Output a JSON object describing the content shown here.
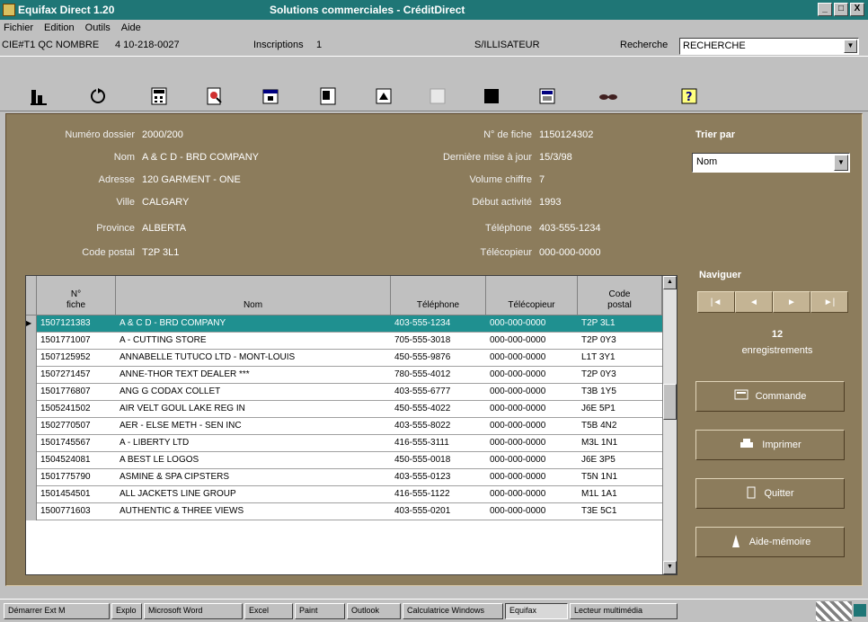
{
  "window": {
    "title_left": "Equifax Direct 1.20",
    "title_mid": "Solutions commerciales - CréditDirect",
    "controls": [
      "_",
      "□",
      "X"
    ]
  },
  "menu": [
    "Fichier",
    "Edition",
    "Outils",
    "Aide"
  ],
  "info": {
    "field1": "CIE#T1 QC NOMBRE",
    "field2": "4 10-218-0027",
    "field3_label": "Inscriptions",
    "field3_value": "1",
    "field4": "S/ILLISATEUR",
    "field5_label": "Recherche",
    "select_value": "RECHERCHE"
  },
  "toolbar": {
    "icons": [
      "report-icon",
      "refresh-icon",
      "calculator-icon",
      "search-document-icon",
      "calendar-icon",
      "form-icon",
      "print-icon",
      "blank-icon",
      "stop-icon",
      "window-icon",
      "glasses-icon",
      "help-icon"
    ]
  },
  "company": {
    "labels": {
      "number": "Numéro dossier",
      "name": "Nom",
      "address": "Adresse",
      "city": "Ville",
      "province": "Province",
      "postal": "Code postal",
      "file_no": "N° de fiche",
      "last_update": "Dernière mise à jour",
      "control": "Volume chiffre",
      "established": "Début activité",
      "phone": "Téléphone",
      "fax": "Télécopieur"
    },
    "values": {
      "number": "2000/200",
      "name": "A & C D - BRD COMPANY",
      "address": "120 GARMENT - ONE",
      "city": "CALGARY",
      "province": "ALBERTA",
      "postal": "T2P 3L1",
      "file_no": "1150124302",
      "last_update": "15/3/98",
      "control": "7",
      "established": "1993",
      "phone": "403-555-1234",
      "fax": "000-000-0000"
    }
  },
  "right_panel": {
    "sort_title": "Trier par",
    "sort_value": "Nom",
    "nav_title": "Naviguer",
    "nav": [
      "|◄",
      "◄",
      "►",
      "►|"
    ],
    "count_number": "12",
    "count_label": "enregistrements",
    "buttons": [
      {
        "label": "Commande",
        "icon": "command-icon"
      },
      {
        "label": "Imprimer",
        "icon": "print-icon"
      },
      {
        "label": "Quitter",
        "icon": "door-icon"
      },
      {
        "label": "Aide-mémoire",
        "icon": "memo-icon"
      }
    ]
  },
  "table": {
    "columns": [
      "N°\nfiche",
      "Nom",
      "Téléphone",
      "Télécopieur",
      "Code\npostal"
    ],
    "rows": [
      {
        "no": "1507121383",
        "name": "A & C D - BRD COMPANY",
        "phone": "403-555-1234",
        "fax": "000-000-0000",
        "postal": "T2P 3L1",
        "selected": true
      },
      {
        "no": "1501771007",
        "name": "A - CUTTING STORE",
        "phone": "705-555-3018",
        "fax": "000-000-0000",
        "postal": "T2P 0Y3",
        "selected": false
      },
      {
        "no": "1507125952",
        "name": "ANNABELLE TUTUCO LTD - MONT-LOUIS",
        "phone": "450-555-9876",
        "fax": "000-000-0000",
        "postal": "L1T 3Y1",
        "selected": false
      },
      {
        "no": "1507271457",
        "name": "ANNE-THOR TEXT DEALER ***",
        "phone": "780-555-4012",
        "fax": "000-000-0000",
        "postal": "T2P 0Y3",
        "selected": false
      },
      {
        "no": "1501776807",
        "name": "ANG G CODAX COLLET",
        "phone": "403-555-6777",
        "fax": "000-000-0000",
        "postal": "T3B 1Y5",
        "selected": false
      },
      {
        "no": "1505241502",
        "name": "AIR VELT GOUL LAKE REG IN",
        "phone": "450-555-4022",
        "fax": "000-000-0000",
        "postal": "J6E 5P1",
        "selected": false
      },
      {
        "no": "1502770507",
        "name": "AER - ELSE METH - SEN INC",
        "phone": "403-555-8022",
        "fax": "000-000-0000",
        "postal": "T5B 4N2",
        "selected": false
      },
      {
        "no": "1501745567",
        "name": "A - LIBERTY LTD",
        "phone": "416-555-3111",
        "fax": "000-000-0000",
        "postal": "M3L 1N1",
        "selected": false
      },
      {
        "no": "1504524081",
        "name": "A BEST LE LOGOS",
        "phone": "450-555-0018",
        "fax": "000-000-0000",
        "postal": "J6E 3P5",
        "selected": false
      },
      {
        "no": "1501775790",
        "name": "ASMINE & SPA CIPSTERS",
        "phone": "403-555-0123",
        "fax": "000-000-0000",
        "postal": "T5N 1N1",
        "selected": false
      },
      {
        "no": "1501454501",
        "name": "ALL JACKETS LINE GROUP",
        "phone": "416-555-1122",
        "fax": "000-000-0000",
        "postal": "M1L 1A1",
        "selected": false
      },
      {
        "no": "1500771603",
        "name": "AUTHENTIC & THREE VIEWS",
        "phone": "403-555-0201",
        "fax": "000-000-0000",
        "postal": "T3E 5C1",
        "selected": false
      }
    ]
  },
  "taskbar": {
    "items": [
      {
        "label": "Démarrer Ext M",
        "active": false
      },
      {
        "label": "Explo",
        "active": false
      },
      {
        "label": "Microsoft Word",
        "active": false
      },
      {
        "label": "Excel",
        "active": false
      },
      {
        "label": "Paint",
        "active": false
      },
      {
        "label": "Outlook",
        "active": false
      },
      {
        "label": "Calculatrice Windows",
        "active": false
      },
      {
        "label": "Equifax",
        "active": true
      },
      {
        "label": "Lecteur multimédia",
        "active": false
      }
    ]
  },
  "colors": {
    "titlebar": "#1f7676",
    "panel": "#8c7c5c",
    "selected_row": "#1f9090"
  }
}
